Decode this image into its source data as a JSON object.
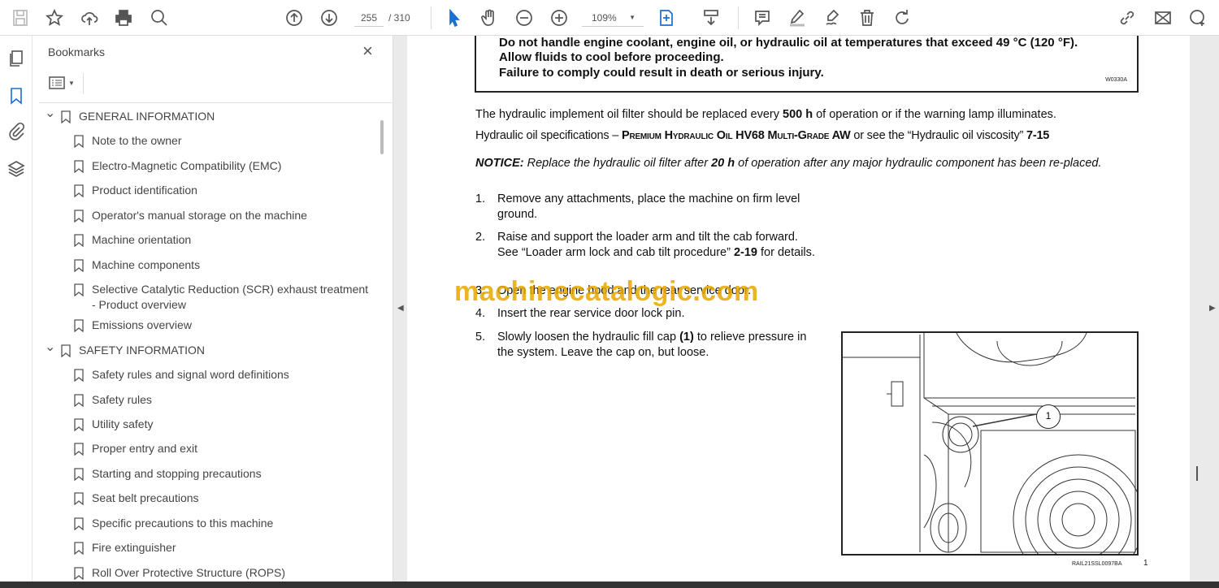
{
  "toolbar": {
    "page_current": "255",
    "page_total": "/ 310",
    "zoom": "109%"
  },
  "bookmarks": {
    "title": "Bookmarks",
    "close": "×",
    "items": [
      {
        "label": "GENERAL INFORMATION",
        "level": 0
      },
      {
        "label": "Note to the owner",
        "level": 1
      },
      {
        "label": "Electro-Magnetic Compatibility (EMC)",
        "level": 1
      },
      {
        "label": "Product identification",
        "level": 1
      },
      {
        "label": "Operator's manual storage on the machine",
        "level": 1
      },
      {
        "label": "Machine orientation",
        "level": 1
      },
      {
        "label": "Machine components",
        "level": 1
      },
      {
        "label": "Selective Catalytic Reduction (SCR) exhaust treatment - Product overview",
        "level": 1
      },
      {
        "label": "Emissions overview",
        "level": 1
      },
      {
        "label": "SAFETY INFORMATION",
        "level": 0
      },
      {
        "label": "Safety rules and signal word definitions",
        "level": 1
      },
      {
        "label": "Safety rules",
        "level": 1
      },
      {
        "label": "Utility safety",
        "level": 1
      },
      {
        "label": "Proper entry and exit",
        "level": 1
      },
      {
        "label": "Starting and stopping precautions",
        "level": 1
      },
      {
        "label": "Seat belt precautions",
        "level": 1
      },
      {
        "label": "Specific precautions to this machine",
        "level": 1
      },
      {
        "label": "Fire extinguisher",
        "level": 1
      },
      {
        "label": "Roll Over Protective Structure (ROPS)",
        "level": 1
      }
    ]
  },
  "doc": {
    "warning": [
      "Do not handle engine coolant, engine oil, or hydraulic oil at temperatures that exceed 49 °C (120 °F).",
      "Allow fluids to cool before proceeding.",
      "Failure to comply could result in death or serious injury."
    ],
    "warning_code": "W0330A",
    "p1a": "The hydraulic implement oil filter should be replaced every ",
    "p1b": "500 h",
    "p1c": " of operation or if the warning lamp illuminates.",
    "p2a": "Hydraulic oil specifications – ",
    "p2b": "Premium Hydraulic Oil HV68 Multi-Grade AW",
    "p2c": " or see the “Hydraulic oil viscosity” ",
    "p2d": "7-15",
    "notice_label": "NOTICE:",
    "notice_a": " Replace the hydraulic oil filter after ",
    "notice_b": "20 h",
    "notice_c": " of operation after any major hydraulic component has been re-placed.",
    "steps": [
      {
        "n": "1.",
        "text": "Remove any attachments, place the machine on firm level ground."
      },
      {
        "n": "2.",
        "text": "Raise and support the loader arm and tilt the cab forward.  See “Loader arm lock and cab tilt procedure” ",
        "bold": "2-19",
        "after": " for details."
      },
      {
        "n": "3.",
        "text": "Open the engine hood and the rear service door."
      },
      {
        "n": "4.",
        "text": "Insert the rear service door lock pin."
      },
      {
        "n": "5.",
        "text": "Slowly loosen the hydraulic fill cap ",
        "bold": "(1)",
        "after": " to relieve pressure in the system. Leave the cap on, but loose."
      }
    ],
    "callout": "1",
    "figure_code": "RAIL21SSL0097BA",
    "page_label": "1"
  },
  "watermark": "machinecatalogic.com"
}
